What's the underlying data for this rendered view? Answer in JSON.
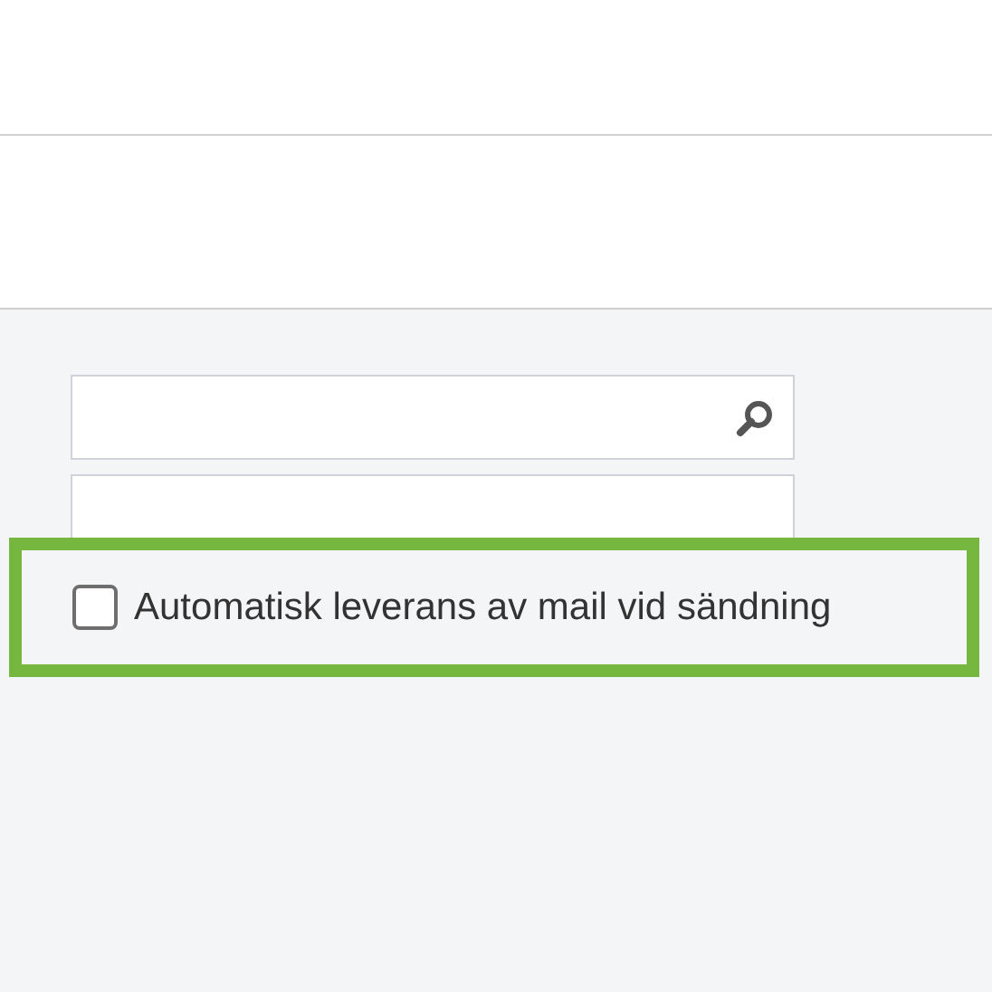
{
  "search": {
    "kind": "search"
  },
  "option": {
    "label": "Automatisk leverans av mail vid sändning",
    "checked": false,
    "highlighted": true
  }
}
